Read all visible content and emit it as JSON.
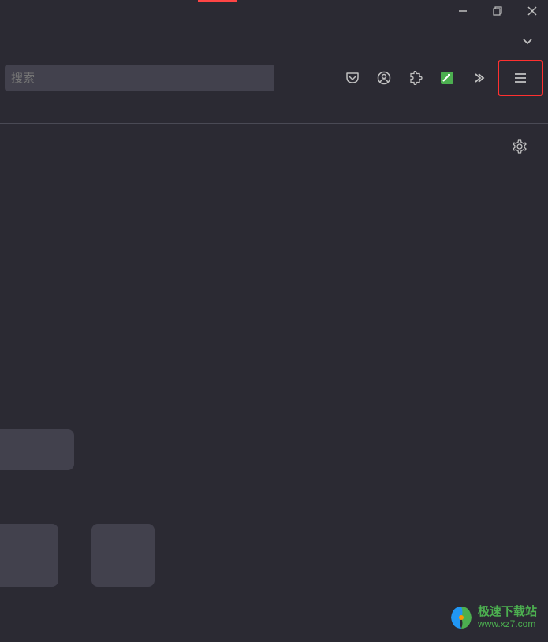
{
  "window": {
    "minimize": "−",
    "maximize": "□",
    "close": "×"
  },
  "search": {
    "placeholder": "搜索"
  },
  "watermark": {
    "name": "极速下载站",
    "url": "www.xz7.com"
  },
  "colors": {
    "bg": "#2b2a33",
    "panel": "#42414d",
    "accent_red": "#ff3030",
    "accent_green": "#4caf50"
  }
}
